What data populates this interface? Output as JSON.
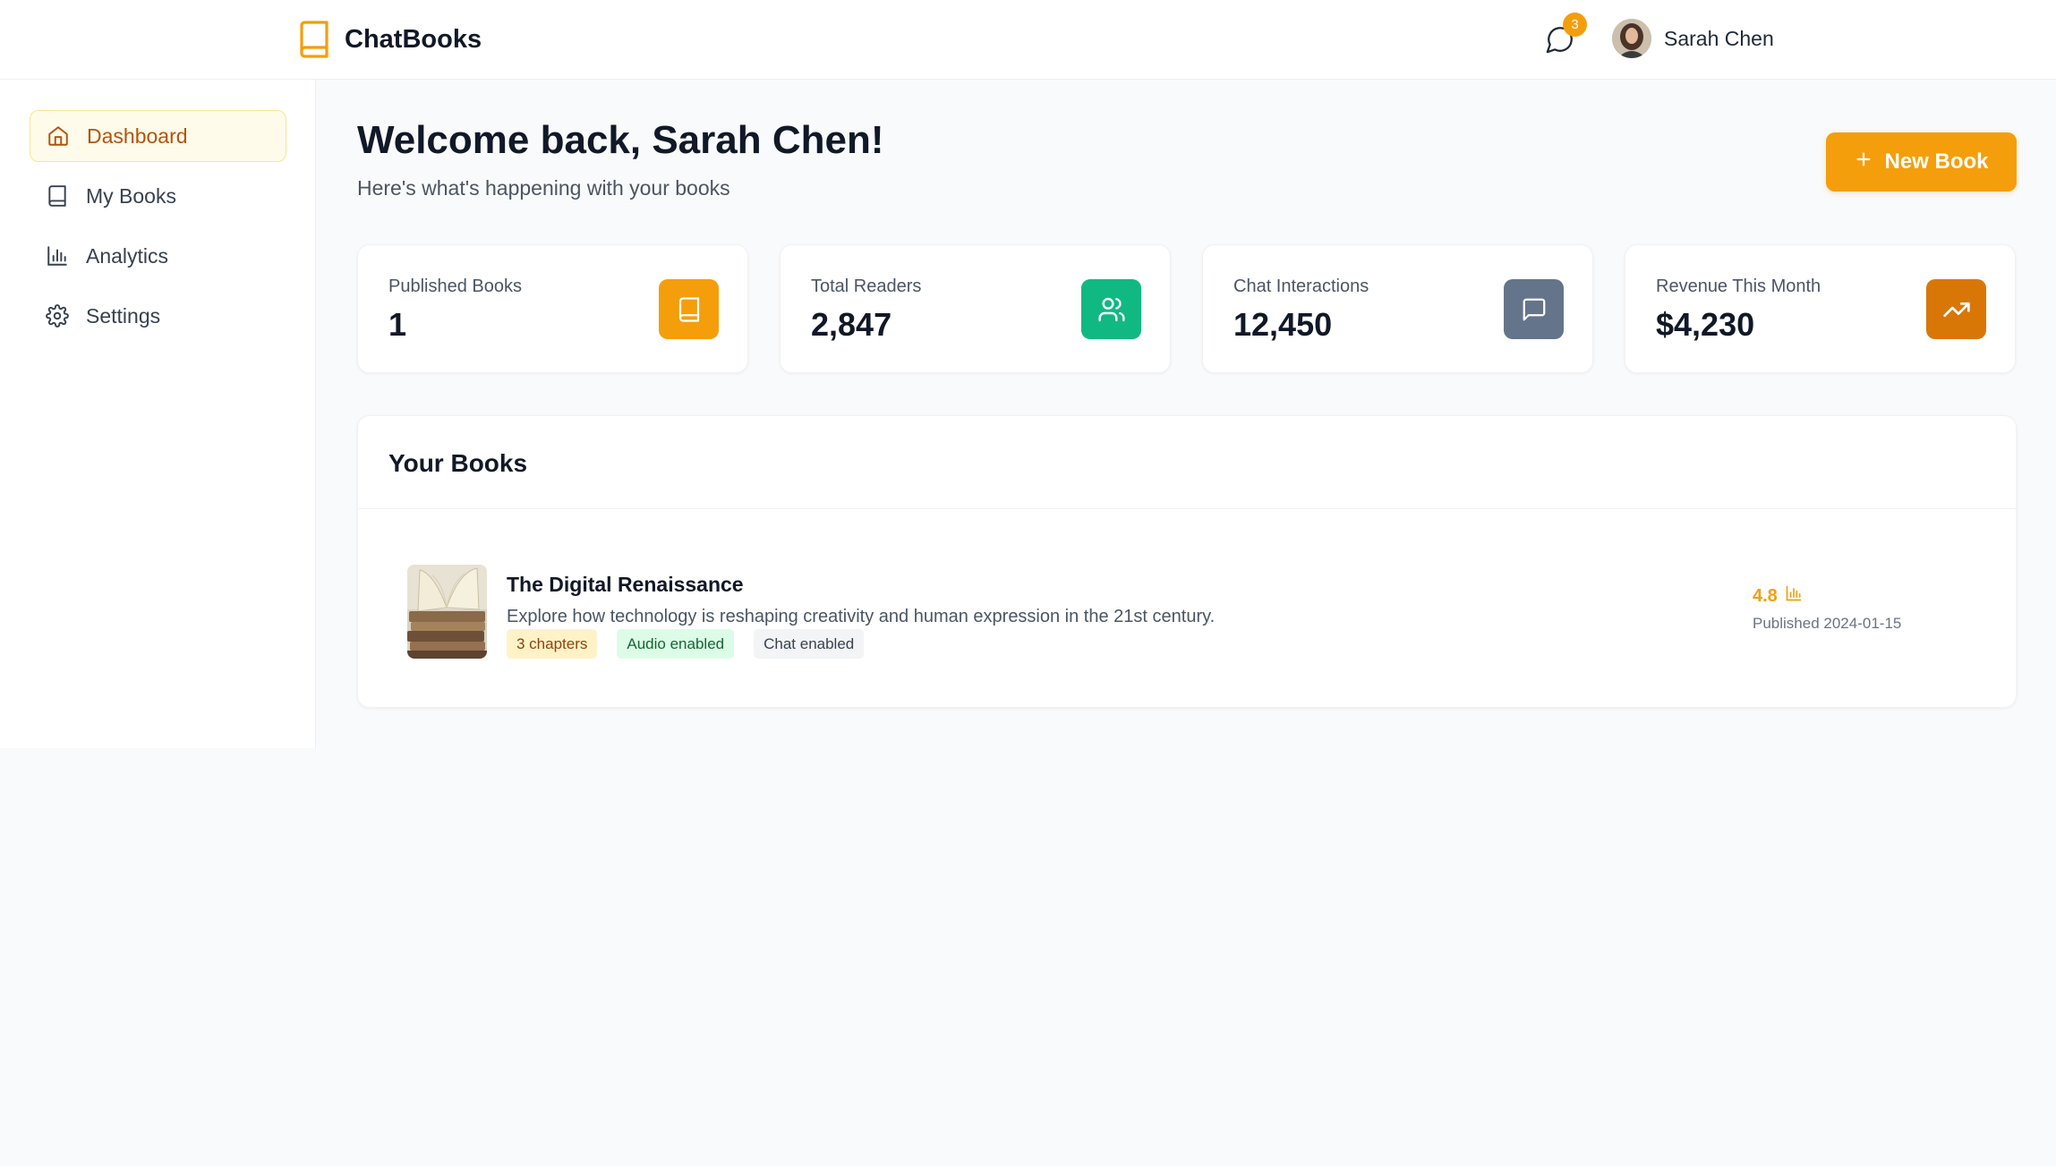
{
  "app": {
    "name": "ChatBooks"
  },
  "header": {
    "notifications_count": "3",
    "user_name": "Sarah Chen"
  },
  "sidebar": {
    "items": [
      {
        "label": "Dashboard",
        "icon": "home-icon",
        "active": true
      },
      {
        "label": "My Books",
        "icon": "book-icon",
        "active": false
      },
      {
        "label": "Analytics",
        "icon": "bar-chart-icon",
        "active": false
      },
      {
        "label": "Settings",
        "icon": "gear-icon",
        "active": false
      }
    ]
  },
  "main": {
    "welcome": "Welcome back, Sarah Chen!",
    "subtitle": "Here's what's happening with your books",
    "new_book_label": "New Book"
  },
  "stats": [
    {
      "label": "Published Books",
      "value": "1",
      "icon": "book-icon",
      "color": "#f59e0b"
    },
    {
      "label": "Total Readers",
      "value": "2,847",
      "icon": "users-icon",
      "color": "#10b981"
    },
    {
      "label": "Chat Interactions",
      "value": "12,450",
      "icon": "message-icon",
      "color": "#64748b"
    },
    {
      "label": "Revenue This Month",
      "value": "$4,230",
      "icon": "trending-up-icon",
      "color": "#d97706"
    }
  ],
  "books": {
    "title": "Your Books",
    "items": [
      {
        "title": "The Digital Renaissance",
        "description": "Explore how technology is reshaping creativity and human expression in the 21st century.",
        "tags": [
          "3 chapters",
          "Audio enabled",
          "Chat enabled"
        ],
        "rating": "4.8",
        "published": "Published 2024-01-15"
      }
    ]
  },
  "colors": {
    "accent": "#f59e0b",
    "background": "#f9fafb"
  }
}
